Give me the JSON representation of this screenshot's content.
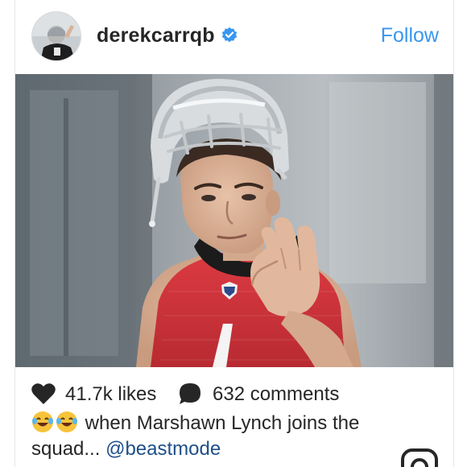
{
  "post": {
    "username": "derekcarrqb",
    "follow_label": "Follow",
    "likes": "41.7k likes",
    "comments": "632 comments",
    "caption_text": "when Marshawn Lynch joins the squad...",
    "caption_mention": "@beastmode",
    "caption_emoji": [
      "joy-emoji",
      "joy-emoji"
    ]
  },
  "icons": {
    "verified": "verified-badge-icon",
    "like": "heart-icon",
    "comment": "comment-bubble-icon",
    "bottom": "instagram-camera-icon"
  },
  "colors": {
    "link_blue": "#3897f0",
    "verified_blue": "#3897f0",
    "mention": "#1e4f8a",
    "text": "#262626",
    "jersey_red": "#d3323a"
  }
}
